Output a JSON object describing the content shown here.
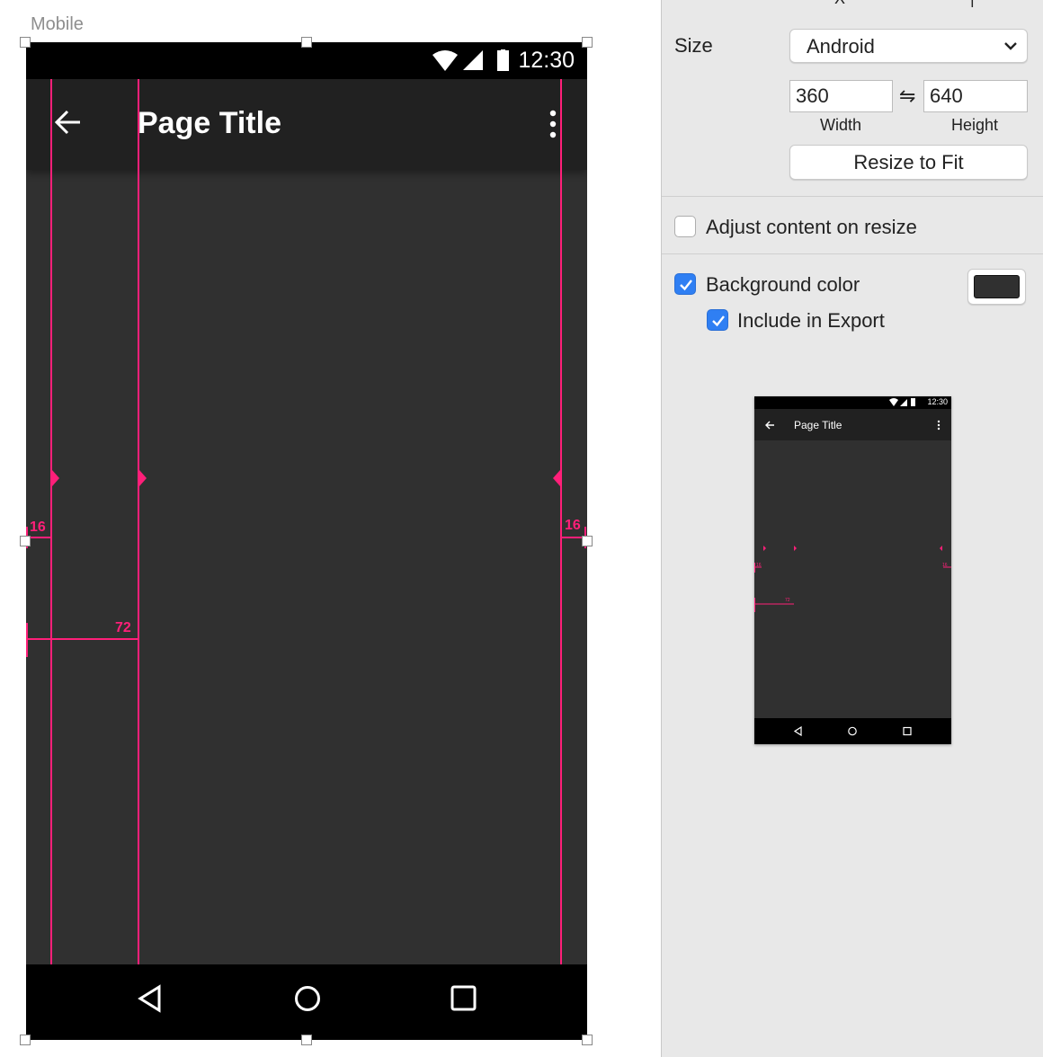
{
  "canvas": {
    "artboard_label": "Mobile"
  },
  "device": {
    "status_time": "12:30",
    "page_title": "Page Title",
    "keyline_labels": {
      "left_margin": "16",
      "right_margin": "16",
      "content_inset": "72"
    },
    "nav_buttons": [
      "back-triangle",
      "home-circle",
      "recents-square"
    ]
  },
  "inspector": {
    "size_label": "Size",
    "size_preset": "Android",
    "width_value": "360",
    "height_value": "640",
    "width_label": "Width",
    "height_label": "Height",
    "swap_symbol": "⇋",
    "resize_button": "Resize to Fit",
    "adjust_content_label": "Adjust content on resize",
    "adjust_content_checked": false,
    "background_color_label": "Background color",
    "background_color_checked": true,
    "background_color": "#303030",
    "include_export_label": "Include in Export",
    "include_export_checked": true
  },
  "preview": {
    "status_time": "12:30",
    "page_title": "Page Title",
    "keyline_labels": {
      "left_margin": "16",
      "right_margin": "16",
      "content_inset": "72"
    }
  },
  "colors": {
    "keyline": "#ff1f79",
    "artboard_bg": "#303030",
    "app_bar": "#212121",
    "system_bars": "#000000",
    "checkbox_accent": "#2f7ff3",
    "inspector_bg": "#e8e8e8"
  }
}
